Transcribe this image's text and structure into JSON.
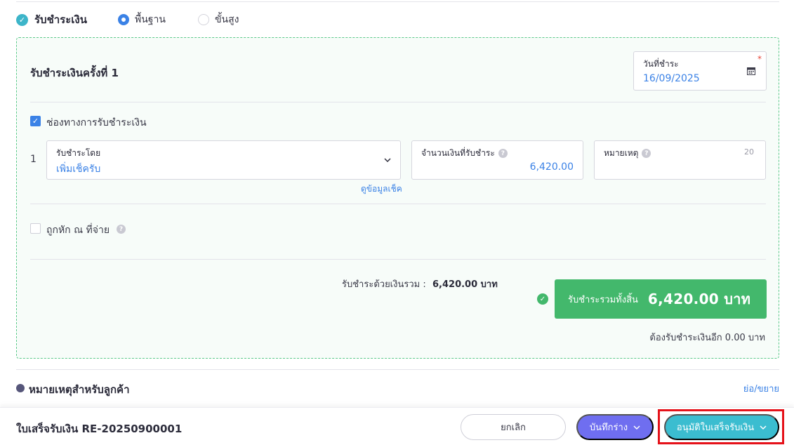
{
  "payment": {
    "section_title": "รับชำระเงิน",
    "mode_options": [
      {
        "label": "พื้นฐาน",
        "selected": true
      },
      {
        "label": "ขั้นสูง",
        "selected": false
      }
    ],
    "installment_title": "รับชำระเงินครั้งที่ 1",
    "date": {
      "label": "วันที่ชำระ",
      "required_mark": "*",
      "value": "16/09/2025",
      "icon": "calendar-icon"
    },
    "channel_checkbox": {
      "label": "ช่องทางการรับชำระเงิน",
      "checked": true
    },
    "line": {
      "index": "1",
      "method": {
        "label": "รับชำระโดย",
        "value": "เพิ่มเช็ครับ"
      },
      "view_cheque_link": "ดูข้อมูลเช็ค",
      "amount": {
        "label": "จำนวนเงินที่รับชำระ",
        "value": "6,420.00"
      },
      "note": {
        "label": "หมายเหตุ",
        "counter": "20"
      }
    },
    "withholding_checkbox": {
      "label": "ถูกหัก ณ ที่จ่าย",
      "checked": false
    },
    "summary": {
      "paid_label": "รับชำระด้วยเงินรวม :",
      "paid_value": "6,420.00 บาท",
      "total_label": "รับชำระรวมทั้งสิ้น",
      "total_value": "6,420.00 บาท",
      "remaining": "ต้องรับชำระเงินอีก 0.00 บาท"
    }
  },
  "customer_remark": {
    "title": "หมายเหตุสำหรับลูกค้า",
    "toggle": "ย่อ/ขยาย"
  },
  "footer": {
    "doc_title": "ใบเสร็จรับเงิน RE-20250900001",
    "cancel_label": "ยกเลิก",
    "draft_label": "บันทึกร่าง",
    "approve_label": "อนุมัติใบเสร็จรับเงิน"
  },
  "colors": {
    "accent_blue": "#3b82e6",
    "success_green": "#43b86c",
    "draft_purple": "#6f6ef0",
    "approve_teal": "#3bbdd0",
    "highlight_red": "#e5121a"
  }
}
